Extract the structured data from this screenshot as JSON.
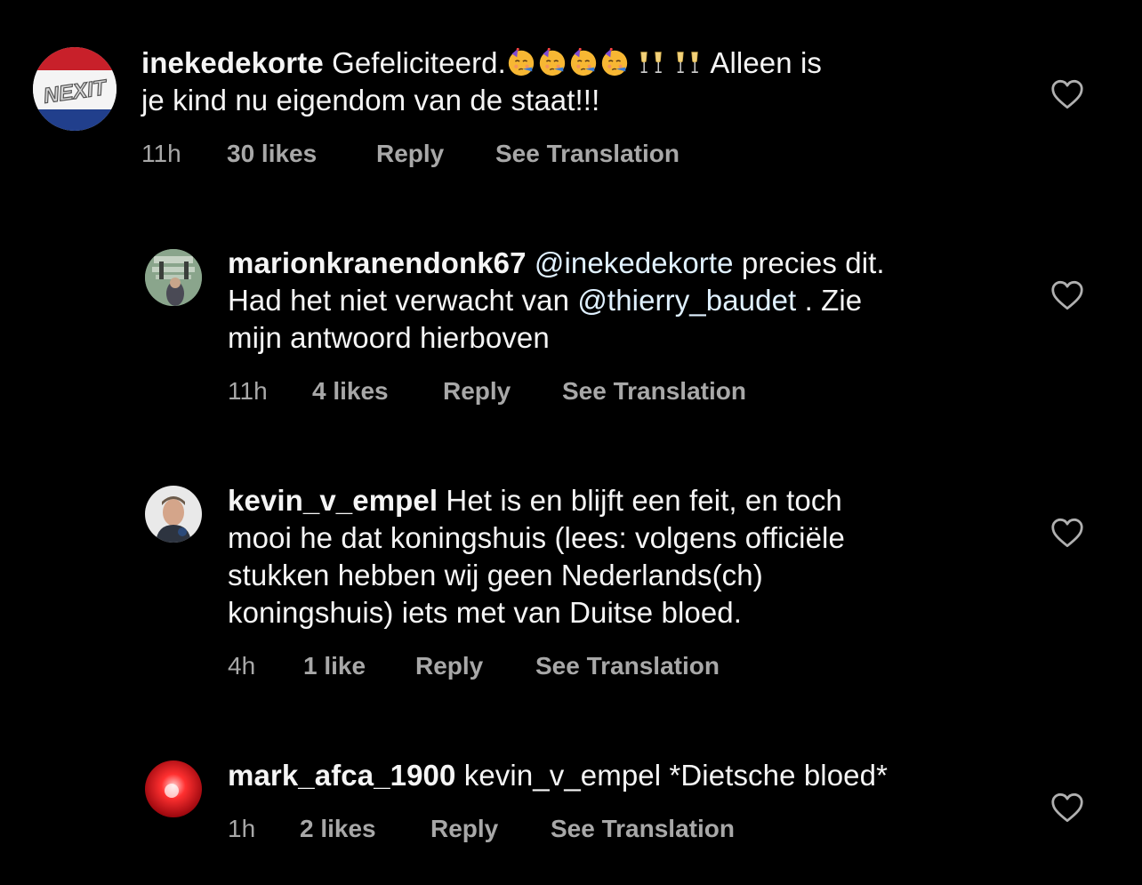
{
  "colors": {
    "background": "#000000",
    "text": "#f5f5f5",
    "meta": "#a8a8a8",
    "mention": "#e0f1ff"
  },
  "comments": [
    {
      "username": "inekedekorte",
      "text_before": "Gefeliciteerd.",
      "emoji": [
        "partying-face",
        "partying-face",
        "partying-face",
        "partying-face",
        "clinking-glasses",
        "clinking-glasses"
      ],
      "text_line1_end": "Alleen is",
      "text_line2": "je kind nu eigendom van de staat!!!",
      "avatar_text": "NEXIT",
      "time": "11h",
      "likes": "30 likes",
      "reply": "Reply",
      "translate": "See Translation"
    },
    {
      "username": "marionkranendonk67",
      "mention1": "@inekedekorte",
      "text1": " precies dit.",
      "text2": "Had het niet verwacht van ",
      "mention2": "@thierry_baudet",
      "text3": " . Zie",
      "text4": "mijn antwoord hierboven",
      "time": "11h",
      "likes": "4 likes",
      "reply": "Reply",
      "translate": "See Translation"
    },
    {
      "username": "kevin_v_empel",
      "line1": " Het is en blijft een feit, en toch",
      "line2": "mooi he dat koningshuis (lees: volgens officiële",
      "line3": "stukken hebben wij geen Nederlands(ch)",
      "line4": "koningshuis) iets met van Duitse bloed.",
      "time": "4h",
      "likes": "1 like",
      "reply": "Reply",
      "translate": "See Translation"
    },
    {
      "username": "mark_afca_1900",
      "text": " kevin_v_empel *Dietsche bloed*",
      "time": "1h",
      "likes": "2 likes",
      "reply": "Reply",
      "translate": "See Translation"
    }
  ]
}
